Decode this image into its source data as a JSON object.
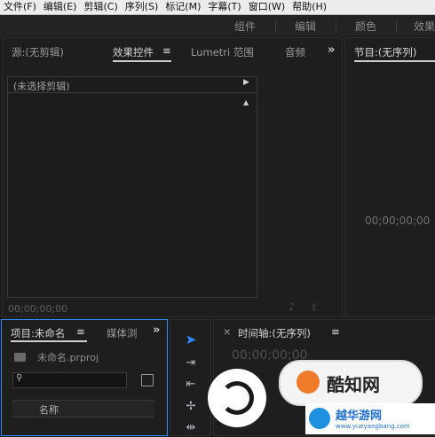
{
  "menubar": {
    "items": [
      "文件(F)",
      "编辑(E)",
      "剪辑(C)",
      "序列(S)",
      "标记(M)",
      "字幕(T)",
      "窗口(W)",
      "帮助(H)"
    ]
  },
  "workspaces": {
    "tabs": [
      "组件",
      "编辑",
      "颜色",
      "效果"
    ]
  },
  "source_panel": {
    "tabs": [
      "源:(无剪辑)",
      "效果控件",
      "Lumetri 范围",
      "音频"
    ],
    "active_tab_menu": "≡",
    "clip_row": "(未选择剪辑)",
    "timecode": "00;00;00;00"
  },
  "program_panel": {
    "title": "节目:(无序列)",
    "timecode": "00;00;00;00"
  },
  "project_panel": {
    "tabs": [
      "项目:未命名",
      "媒体浏"
    ],
    "menu": "≡",
    "project_file": "未命名.prproj",
    "search_placeholder": "",
    "column_header": "名称"
  },
  "timeline_panel": {
    "close": "×",
    "title": "时间轴:(无序列)",
    "menu": "≡",
    "timecode": "00;00;00;00"
  },
  "watermark": {
    "text": "酷知网",
    "footer_brand": "越华游网",
    "footer_url": "www.yueyangbang.com"
  },
  "colors": {
    "accent_blue": "#2d8cff",
    "panel_bg": "#1e1e1e",
    "menubar_bg": "#ececec"
  }
}
